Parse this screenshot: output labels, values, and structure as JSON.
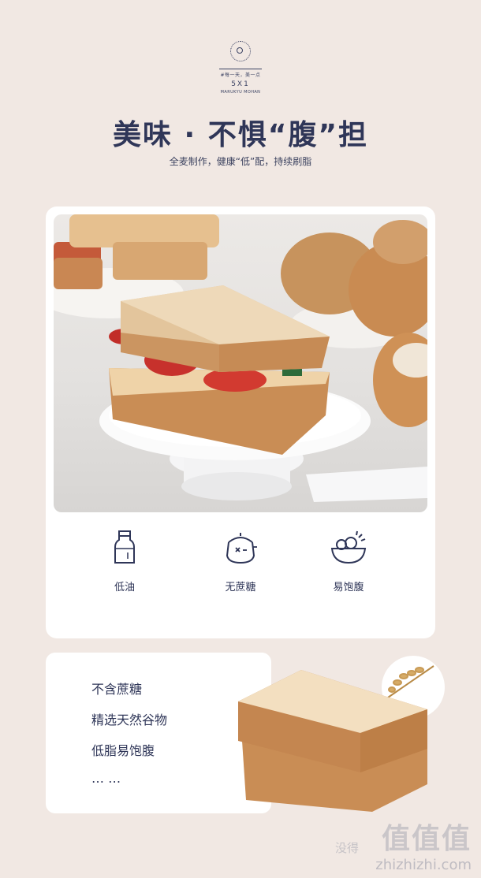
{
  "header": {
    "tagline": "#每一天，美一点",
    "number": "5X1",
    "brand": "MARUKYU MOHAN",
    "title": "美味 · 不惧“腹”担",
    "subtitle": "全麦制作，健康“低”配，持续刷脂"
  },
  "features": [
    {
      "label": "低油",
      "icon": "bottle-icon"
    },
    {
      "label": "无蔗糖",
      "icon": "sugar-jar-icon"
    },
    {
      "label": "易饱腹",
      "icon": "bowl-icon"
    }
  ],
  "points": [
    "不含蔗糖",
    "精选天然谷物",
    "低脂易饱腹",
    "… …"
  ],
  "watermark": {
    "text": "值值值",
    "left_text": "没得",
    "site": "zhizhizhi.com"
  },
  "colors": {
    "background": "#f1e8e3",
    "text": "#2f3658",
    "card": "#ffffff"
  }
}
